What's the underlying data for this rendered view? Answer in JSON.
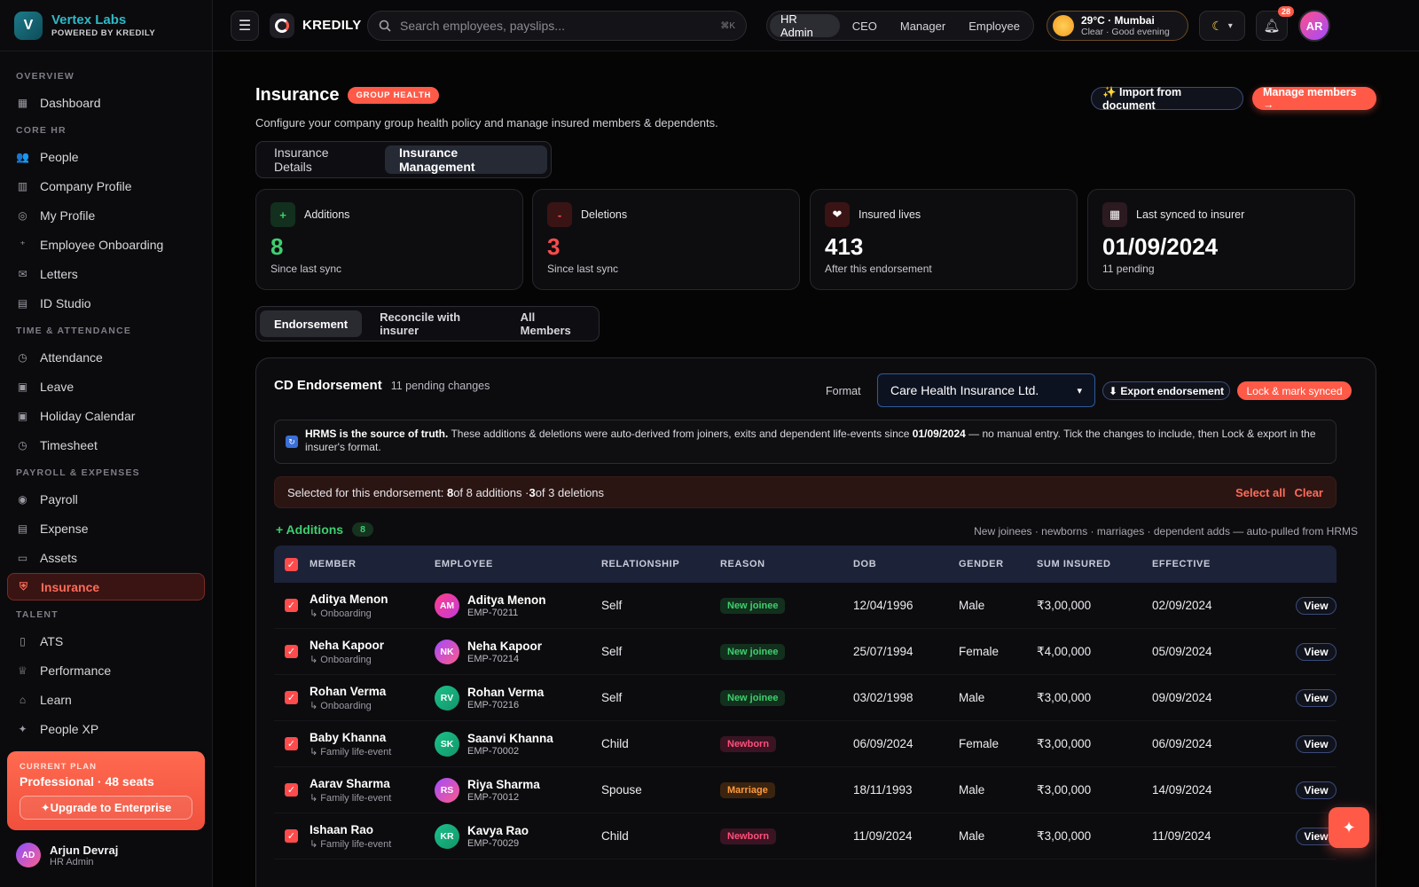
{
  "brand": {
    "logo_letter": "V",
    "name": "Vertex Labs",
    "powered": "POWERED BY KREDILY"
  },
  "sidebar": {
    "sections": [
      {
        "title": "OVERVIEW",
        "items": [
          {
            "label": "Dashboard",
            "icon": "grid-icon",
            "glyph": "▦"
          }
        ]
      },
      {
        "title": "CORE HR",
        "items": [
          {
            "label": "People",
            "icon": "people-icon",
            "glyph": "👥"
          },
          {
            "label": "Company Profile",
            "icon": "building-icon",
            "glyph": "▥"
          },
          {
            "label": "My Profile",
            "icon": "user-icon",
            "glyph": "◎"
          },
          {
            "label": "Employee Onboarding",
            "icon": "user-plus-icon",
            "glyph": "⁺"
          },
          {
            "label": "Letters",
            "icon": "mail-icon",
            "glyph": "✉"
          },
          {
            "label": "ID Studio",
            "icon": "id-card-icon",
            "glyph": "▤"
          }
        ]
      },
      {
        "title": "TIME & ATTENDANCE",
        "items": [
          {
            "label": "Attendance",
            "icon": "clock-icon",
            "glyph": "◷"
          },
          {
            "label": "Leave",
            "icon": "calendar-check-icon",
            "glyph": "▣"
          },
          {
            "label": "Holiday Calendar",
            "icon": "calendar-icon",
            "glyph": "▣"
          },
          {
            "label": "Timesheet",
            "icon": "timer-icon",
            "glyph": "◷"
          }
        ]
      },
      {
        "title": "PAYROLL & EXPENSES",
        "items": [
          {
            "label": "Payroll",
            "icon": "coin-icon",
            "glyph": "◉"
          },
          {
            "label": "Expense",
            "icon": "receipt-icon",
            "glyph": "▤"
          },
          {
            "label": "Assets",
            "icon": "monitor-icon",
            "glyph": "▭"
          },
          {
            "label": "Insurance",
            "icon": "shield-icon",
            "glyph": "⛨",
            "active": true
          }
        ]
      },
      {
        "title": "TALENT",
        "items": [
          {
            "label": "ATS",
            "icon": "clipboard-icon",
            "glyph": "▯"
          },
          {
            "label": "Performance",
            "icon": "trophy-icon",
            "glyph": "♕"
          },
          {
            "label": "Learn",
            "icon": "graduation-cap-icon",
            "glyph": "⌂"
          },
          {
            "label": "People XP",
            "icon": "sparkle-icon",
            "glyph": "✦"
          }
        ]
      }
    ],
    "plan": {
      "label": "CURRENT PLAN",
      "name": "Professional · 48 seats",
      "upgrade": "✦Upgrade to Enterprise"
    },
    "user": {
      "initials": "AD",
      "name": "Arjun Devraj",
      "role": "HR Admin"
    }
  },
  "topbar": {
    "app_name": "KREDILY",
    "search_placeholder": "Search employees, payslips...",
    "search_shortcut": "⌘K",
    "roles": [
      "HR Admin",
      "CEO",
      "Manager",
      "Employee"
    ],
    "active_role": "HR Admin",
    "weather_line1": "29°C · Mumbai",
    "weather_line2": "Clear · Good evening",
    "notifications": "28",
    "avatar": "AR"
  },
  "page": {
    "title": "Insurance",
    "badge": "GROUP HEALTH",
    "subtitle": "Configure your company group health policy and manage insured members & dependents.",
    "import_label": "✨ Import from document",
    "manage_label": "Manage members →",
    "tabs": [
      "Insurance Details",
      "Insurance Management"
    ],
    "active_tab": "Insurance Management"
  },
  "stats": [
    {
      "label": "Additions",
      "value": "8",
      "sub": "Since last sync",
      "icon": "plus-icon",
      "glyph": "+",
      "color": "#3ecf6e",
      "bg": "#12301d"
    },
    {
      "label": "Deletions",
      "value": "3",
      "sub": "Since last sync",
      "icon": "minus-icon",
      "glyph": "-",
      "color": "#ff4b4b",
      "bg": "#3a1414"
    },
    {
      "label": "Insured lives",
      "value": "413",
      "sub": "After this endorsement",
      "icon": "heart-icon",
      "glyph": "❤",
      "color": "#ffffff",
      "bg": "#3a1414"
    },
    {
      "label": "Last synced to insurer",
      "value": "01/09/2024",
      "sub": "11 pending",
      "icon": "calendar-icon",
      "glyph": "▦",
      "color": "#ffffff",
      "bg": "#2b1a20"
    }
  ],
  "subtabs": [
    "Endorsement",
    "Reconcile with insurer",
    "All Members"
  ],
  "active_subtab": "Endorsement",
  "panel": {
    "title": "CD Endorsement",
    "pending": "11 pending changes",
    "format_label": "Format",
    "format_value": "Care Health Insurance Ltd.",
    "export_label": "⬇ Export endorsement",
    "lock_label": "Lock & mark synced",
    "info_bold": "HRMS is the source of truth.",
    "info_text_1": " These additions & deletions were auto-derived from joiners, exits and dependent life-events since ",
    "info_date": "01/09/2024",
    "info_text_2": " — no manual entry. Tick the changes to include, then Lock & export in the insurer's format.",
    "sel_prefix": "Selected for this endorsement: ",
    "sel_add_n": "8",
    "sel_add_mid": " of 8 additions · ",
    "sel_del_n": "3",
    "sel_del_mid": " of 3 deletions",
    "select_all": "Select all",
    "clear": "Clear",
    "additions_title": "+ Additions",
    "additions_count": "8",
    "additions_note": "New joinees · newborns · marriages · dependent adds — auto-pulled from HRMS"
  },
  "table": {
    "columns": [
      "MEMBER",
      "EMPLOYEE",
      "RELATIONSHIP",
      "REASON",
      "DOB",
      "GENDER",
      "SUM INSURED",
      "EFFECTIVE"
    ],
    "view_label": "View",
    "rows": [
      {
        "member": "Aditya Menon",
        "source": "↳ Onboarding",
        "emp_initials": "AM",
        "emp_name": "Aditya Menon",
        "emp_id": "EMP-70211",
        "av_color": "linear-gradient(135deg,#ff3e8a,#c43ad8)",
        "relationship": "Self",
        "reason": "New joinee",
        "reason_kind": "green",
        "dob": "12/04/1996",
        "gender": "Male",
        "sum": "₹3,00,000",
        "effective": "02/09/2024"
      },
      {
        "member": "Neha Kapoor",
        "source": "↳ Onboarding",
        "emp_initials": "NK",
        "emp_name": "Neha Kapoor",
        "emp_id": "EMP-70214",
        "av_color": "linear-gradient(135deg,#a24bff,#ff5a8a)",
        "relationship": "Self",
        "reason": "New joinee",
        "reason_kind": "green",
        "dob": "25/07/1994",
        "gender": "Female",
        "sum": "₹4,00,000",
        "effective": "05/09/2024"
      },
      {
        "member": "Rohan Verma",
        "source": "↳ Onboarding",
        "emp_initials": "RV",
        "emp_name": "Rohan Verma",
        "emp_id": "EMP-70216",
        "av_color": "linear-gradient(135deg,#1cc08a,#12966a)",
        "relationship": "Self",
        "reason": "New joinee",
        "reason_kind": "green",
        "dob": "03/02/1998",
        "gender": "Male",
        "sum": "₹3,00,000",
        "effective": "09/09/2024"
      },
      {
        "member": "Baby Khanna",
        "source": "↳ Family life-event",
        "emp_initials": "SK",
        "emp_name": "Saanvi Khanna",
        "emp_id": "EMP-70002",
        "av_color": "linear-gradient(135deg,#1cc08a,#12966a)",
        "relationship": "Child",
        "reason": "Newborn",
        "reason_kind": "pink",
        "dob": "06/09/2024",
        "gender": "Female",
        "sum": "₹3,00,000",
        "effective": "06/09/2024"
      },
      {
        "member": "Aarav Sharma",
        "source": "↳ Family life-event",
        "emp_initials": "RS",
        "emp_name": "Riya Sharma",
        "emp_id": "EMP-70012",
        "av_color": "linear-gradient(135deg,#a24bff,#ff5a8a)",
        "relationship": "Spouse",
        "reason": "Marriage",
        "reason_kind": "orange",
        "dob": "18/11/1993",
        "gender": "Male",
        "sum": "₹3,00,000",
        "effective": "14/09/2024"
      },
      {
        "member": "Ishaan Rao",
        "source": "↳ Family life-event",
        "emp_initials": "KR",
        "emp_name": "Kavya Rao",
        "emp_id": "EMP-70029",
        "av_color": "linear-gradient(135deg,#1cc08a,#12966a)",
        "relationship": "Child",
        "reason": "Newborn",
        "reason_kind": "pink",
        "dob": "11/09/2024",
        "gender": "Male",
        "sum": "₹3,00,000",
        "effective": "11/09/2024"
      }
    ]
  },
  "colors": {
    "accent": "#ff5a48",
    "brand": "#2fb8c7",
    "success": "#3ecf6e",
    "danger": "#ff4b4b"
  },
  "fab_glyph": "✦"
}
